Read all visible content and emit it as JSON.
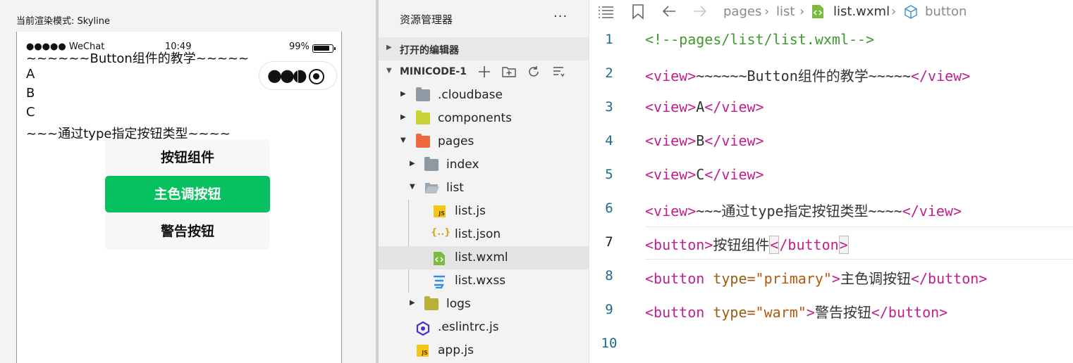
{
  "simulator": {
    "render_mode": "当前渲染模式: Skyline",
    "status": {
      "signal": "●●●●● WeChat",
      "time": "10:49",
      "battery": "99%"
    },
    "texts": [
      "~~~~~~Button组件的教学~~~~~",
      "A",
      "B",
      "C",
      "~~~通过type指定按钮类型~~~~"
    ],
    "buttons": [
      {
        "label": "按钮组件",
        "type": "default"
      },
      {
        "label": "主色调按钮",
        "type": "primary"
      },
      {
        "label": "警告按钮",
        "type": "warn"
      }
    ],
    "primary_color": "#07c160"
  },
  "explorer": {
    "title": "资源管理器",
    "more": "···",
    "sections": {
      "open_editors": "打开的编辑器",
      "project": "MINICODE-1"
    },
    "tree": [
      {
        "name": ".cloudbase",
        "icon": "folder-icon"
      },
      {
        "name": "components",
        "icon": "components-folder-icon"
      },
      {
        "name": "pages",
        "icon": "pages-folder-icon"
      },
      {
        "name": "index",
        "icon": "folder-icon"
      },
      {
        "name": "list",
        "icon": "folder-open-icon"
      },
      {
        "name": "list.js",
        "icon": "js-file-icon"
      },
      {
        "name": "list.json",
        "icon": "json-file-icon"
      },
      {
        "name": "list.wxml",
        "icon": "wxml-file-icon"
      },
      {
        "name": "list.wxss",
        "icon": "wxss-file-icon"
      },
      {
        "name": "logs",
        "icon": "logs-folder-icon"
      },
      {
        "name": ".eslintrc.js",
        "icon": "eslint-file-icon"
      },
      {
        "name": "app.js",
        "icon": "js-file-icon"
      }
    ]
  },
  "editor": {
    "breadcrumb": {
      "pages": "pages",
      "list": "list",
      "file": "list.wxml",
      "symbol": "button",
      "sep": "›"
    },
    "lines": [
      {
        "n": "1",
        "comment": "<!--pages/list/list.wxml-->"
      },
      {
        "n": "2",
        "open": "<view>",
        "text": "~~~~~~Button组件的教学~~~~~",
        "close": "</view>"
      },
      {
        "n": "3",
        "open": "<view>",
        "text": "A",
        "close": "</view>"
      },
      {
        "n": "4",
        "open": "<view>",
        "text": "B",
        "close": "</view>"
      },
      {
        "n": "5",
        "open": "<view>",
        "text": "C",
        "close": "</view>"
      },
      {
        "n": "6",
        "open": "<view>",
        "text": "~~~通过type指定按钮类型~~~~",
        "close": "</view>"
      },
      {
        "n": "7",
        "open": "<button>",
        "text": "按钮组件",
        "close_lt": "<",
        "close_rest": "/button",
        "close_gt": ">"
      },
      {
        "n": "8",
        "tag": "<button",
        "attr": " type=",
        "val": "\"primary\"",
        "gt": ">",
        "text": "主色调按钮",
        "close": "</button>"
      },
      {
        "n": "9",
        "tag": "<button",
        "attr": " type=",
        "val": "\"warm\"",
        "gt": ">",
        "text": "警告按钮",
        "close": "</button>"
      },
      {
        "n": "10"
      }
    ]
  }
}
